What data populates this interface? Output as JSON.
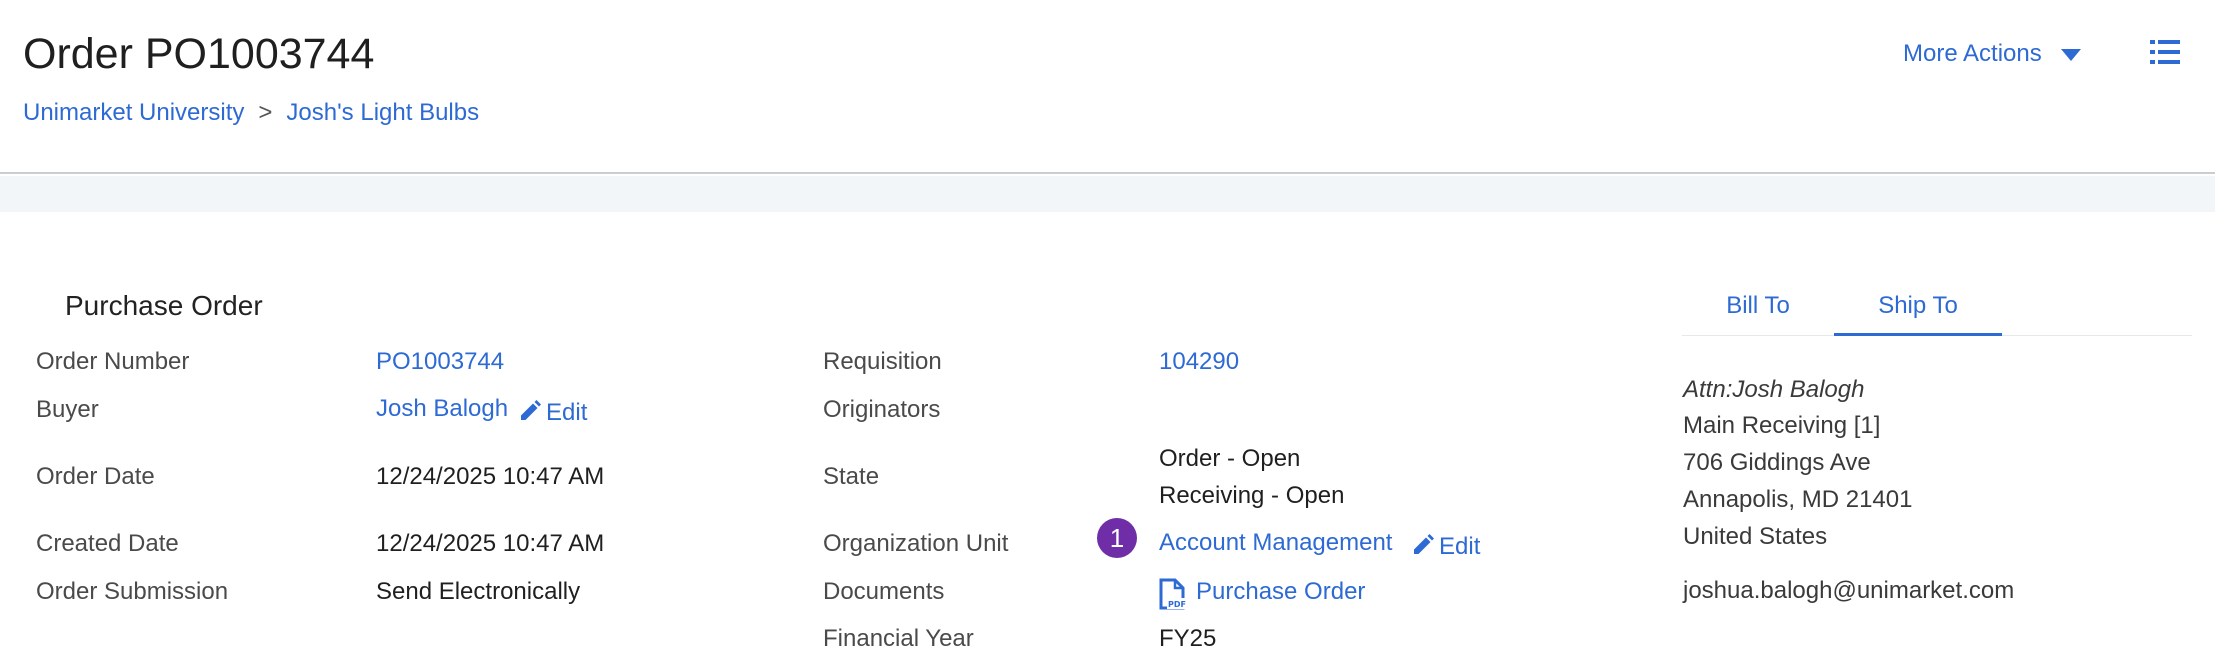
{
  "header": {
    "title": "Order PO1003744",
    "breadcrumb": [
      "Unimarket University",
      "Josh's Light Bulbs"
    ],
    "breadcrumb_separator": ">",
    "more_actions_label": "More Actions",
    "icons": {
      "more_actions": "caret-down-icon",
      "list": "list-icon"
    }
  },
  "section": {
    "title": "Purchase Order"
  },
  "left_fields": {
    "order_number": {
      "label": "Order Number",
      "value": "PO1003744"
    },
    "buyer": {
      "label": "Buyer",
      "value": "Josh Balogh",
      "edit_label": "Edit"
    },
    "order_date": {
      "label": "Order Date",
      "value": "12/24/2025 10:47 AM"
    },
    "created_date": {
      "label": "Created Date",
      "value": "12/24/2025 10:47 AM"
    },
    "order_submission": {
      "label": "Order Submission",
      "value": "Send Electronically"
    }
  },
  "right_fields": {
    "requisition": {
      "label": "Requisition",
      "value": "104290"
    },
    "originators": {
      "label": "Originators",
      "value": ""
    },
    "state": {
      "label": "State",
      "values": [
        "Order - Open",
        "Receiving - Open"
      ]
    },
    "organization_unit": {
      "label": "Organization Unit",
      "badge": "1",
      "value": "Account Management",
      "edit_label": "Edit"
    },
    "documents": {
      "label": "Documents",
      "value": "Purchase Order",
      "icon": "pdf-file-icon"
    },
    "financial_year": {
      "label": "Financial Year",
      "value": "FY25"
    }
  },
  "address_panel": {
    "tabs": [
      {
        "label": "Bill To",
        "active": false
      },
      {
        "label": "Ship To",
        "active": true
      }
    ],
    "attn": "Attn:Josh Balogh",
    "lines": [
      "Main Receiving [1]",
      "706 Giddings Ave",
      "Annapolis, MD 21401",
      "United States"
    ],
    "email": "joshua.balogh@unimarket.com"
  },
  "colors": {
    "link": "#2d6ad4",
    "badge": "#6f2da8",
    "band": "#f3f6f9"
  }
}
